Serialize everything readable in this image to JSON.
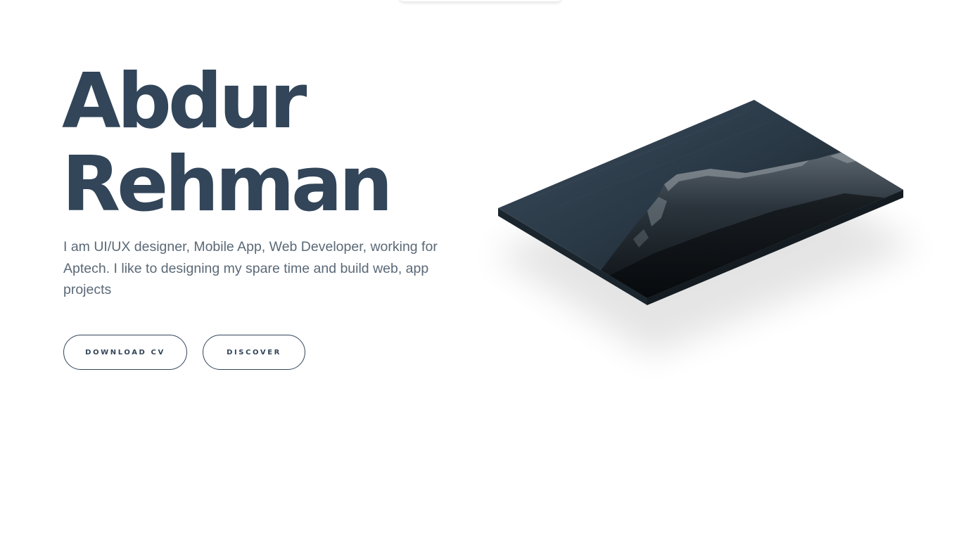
{
  "hero": {
    "name_line1": "Abdur",
    "name_line2": "Rehman",
    "description": "I am UI/UX designer, Mobile App, Web Developer, working for Aptech. I like to designing my spare time and build web, app projects"
  },
  "buttons": {
    "download_cv": "DOWNLOAD CV",
    "discover": "DISCOVER"
  },
  "colors": {
    "heading": "#324559",
    "body_text": "#5b6977",
    "button_border": "#324559",
    "background": "#ffffff"
  }
}
